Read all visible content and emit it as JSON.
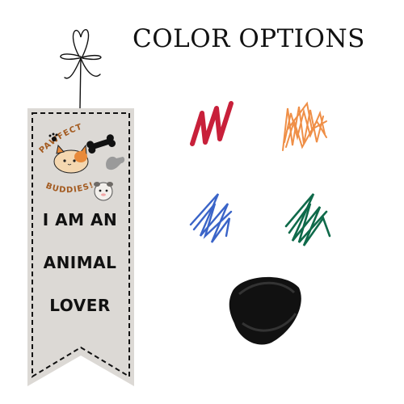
{
  "header": {
    "title": "COLOR OPTIONS"
  },
  "banner": {
    "arc_words": [
      "PAWFECT",
      "BUDDIES!"
    ],
    "lines": [
      "I AM AN",
      "ANIMAL",
      "LOVER"
    ]
  },
  "swatches": [
    {
      "name": "red",
      "color": "#c8203a"
    },
    {
      "name": "orange",
      "color": "#ef8a3e"
    },
    {
      "name": "blue",
      "color": "#3a64c8"
    },
    {
      "name": "green",
      "color": "#0f6a4a"
    },
    {
      "name": "black",
      "color": "#111111"
    }
  ],
  "banner_fill": "#dcd9d5"
}
